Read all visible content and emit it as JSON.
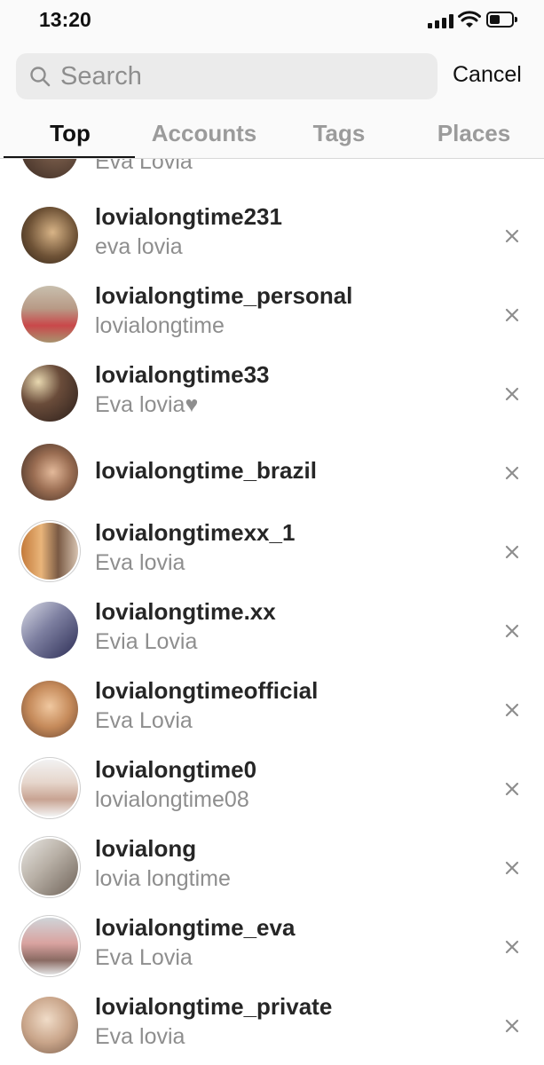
{
  "status_bar": {
    "time": "13:20"
  },
  "search": {
    "placeholder": "Search",
    "value": "",
    "cancel_label": "Cancel"
  },
  "tabs": [
    {
      "label": "Top",
      "active": true
    },
    {
      "label": "Accounts",
      "active": false
    },
    {
      "label": "Tags",
      "active": false
    },
    {
      "label": "Places",
      "active": false
    }
  ],
  "results": [
    {
      "username": "",
      "fullname": "Eva  Lovia"
    },
    {
      "username": "lovialongtime231",
      "fullname": "eva lovia"
    },
    {
      "username": "lovialongtime_personal",
      "fullname": "lovialongtime"
    },
    {
      "username": "lovialongtime33",
      "fullname": "Eva lovia♥"
    },
    {
      "username": "lovialongtime_brazil",
      "fullname": ""
    },
    {
      "username": "lovialongtimexx_1",
      "fullname": "Eva lovia"
    },
    {
      "username": "lovialongtime.xx",
      "fullname": "Evia Lovia"
    },
    {
      "username": "lovialongtimeofficial",
      "fullname": "Eva Lovia"
    },
    {
      "username": "lovialongtime0",
      "fullname": "lovialongtime08"
    },
    {
      "username": "lovialong",
      "fullname": "lovia longtime"
    },
    {
      "username": "lovialongtime_eva",
      "fullname": "Eva Lovia"
    },
    {
      "username": "lovialongtime_private",
      "fullname": "Eva lovia"
    }
  ],
  "colors": {
    "primary_text": "#262626",
    "secondary_text": "#8e8e8e",
    "inactive_tab": "#9b9b9b",
    "search_bg": "#ebebeb"
  },
  "icons": {
    "search": "magnifier-icon",
    "remove": "close-x-icon"
  }
}
